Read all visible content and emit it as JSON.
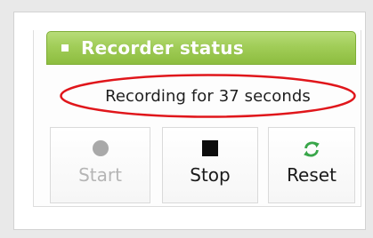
{
  "widget": {
    "title": "Recorder status"
  },
  "status": {
    "text": "Recording for 37 seconds",
    "highlight_color": "#e0161b"
  },
  "buttons": [
    {
      "label": "Start",
      "icon": "circle-icon",
      "enabled": false
    },
    {
      "label": "Stop",
      "icon": "stop-square-icon",
      "enabled": true
    },
    {
      "label": "Reset",
      "icon": "refresh-icon",
      "enabled": true
    }
  ],
  "colors": {
    "header_green": "#a1cd58",
    "reset_icon_green": "#39a64a",
    "disabled_text": "#b5b5b5"
  }
}
